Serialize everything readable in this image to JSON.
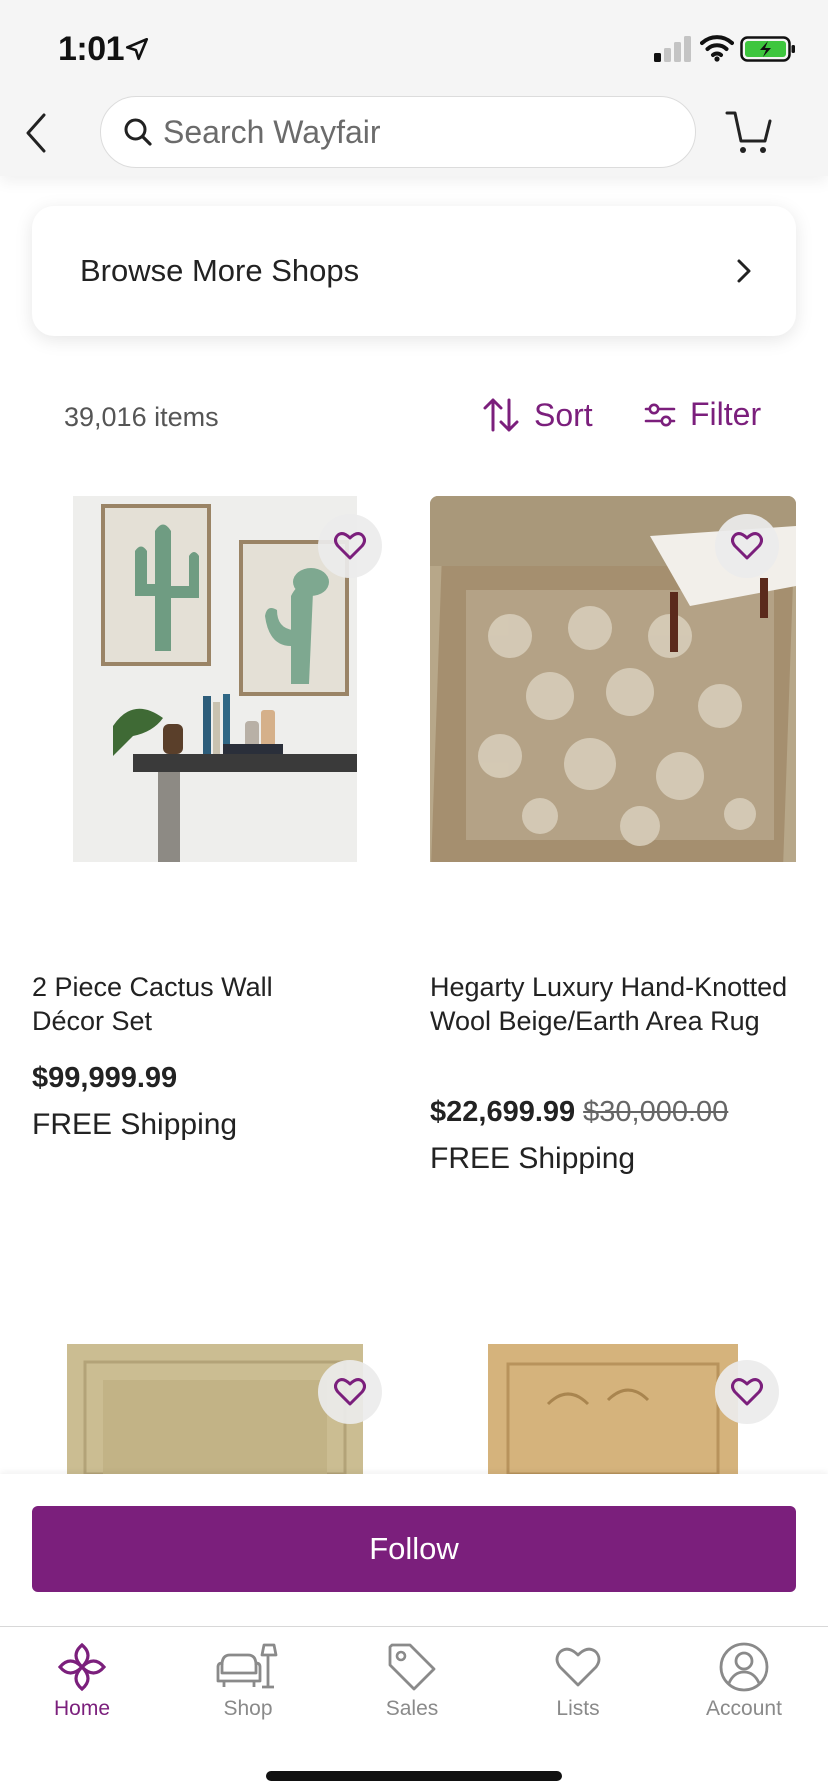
{
  "status_bar": {
    "time": "1:01"
  },
  "header": {
    "search_placeholder": "Search Wayfair"
  },
  "browse_card": {
    "label": "Browse More Shops"
  },
  "toolbar": {
    "items_count": "39,016 items",
    "sort_label": "Sort",
    "filter_label": "Filter"
  },
  "products": [
    {
      "title": "2 Piece Cactus Wall Décor Set",
      "price": "$99,999.99",
      "original_price": "",
      "shipping": "FREE Shipping"
    },
    {
      "title": "Hegarty Luxury Hand-Knotted Wool Beige/Earth Area Rug",
      "price": "$22,699.99",
      "original_price": "$30,000.00",
      "shipping": "FREE Shipping"
    }
  ],
  "follow": {
    "label": "Follow"
  },
  "bottom_nav": [
    {
      "label": "Home",
      "icon": "home-icon",
      "active": true
    },
    {
      "label": "Shop",
      "icon": "shop-icon",
      "active": false
    },
    {
      "label": "Sales",
      "icon": "sales-tag-icon",
      "active": false
    },
    {
      "label": "Lists",
      "icon": "heart-icon",
      "active": false
    },
    {
      "label": "Account",
      "icon": "account-icon",
      "active": false
    }
  ],
  "colors": {
    "brand": "#7b1f7c",
    "text": "#222222",
    "muted": "#8a8a8a"
  }
}
